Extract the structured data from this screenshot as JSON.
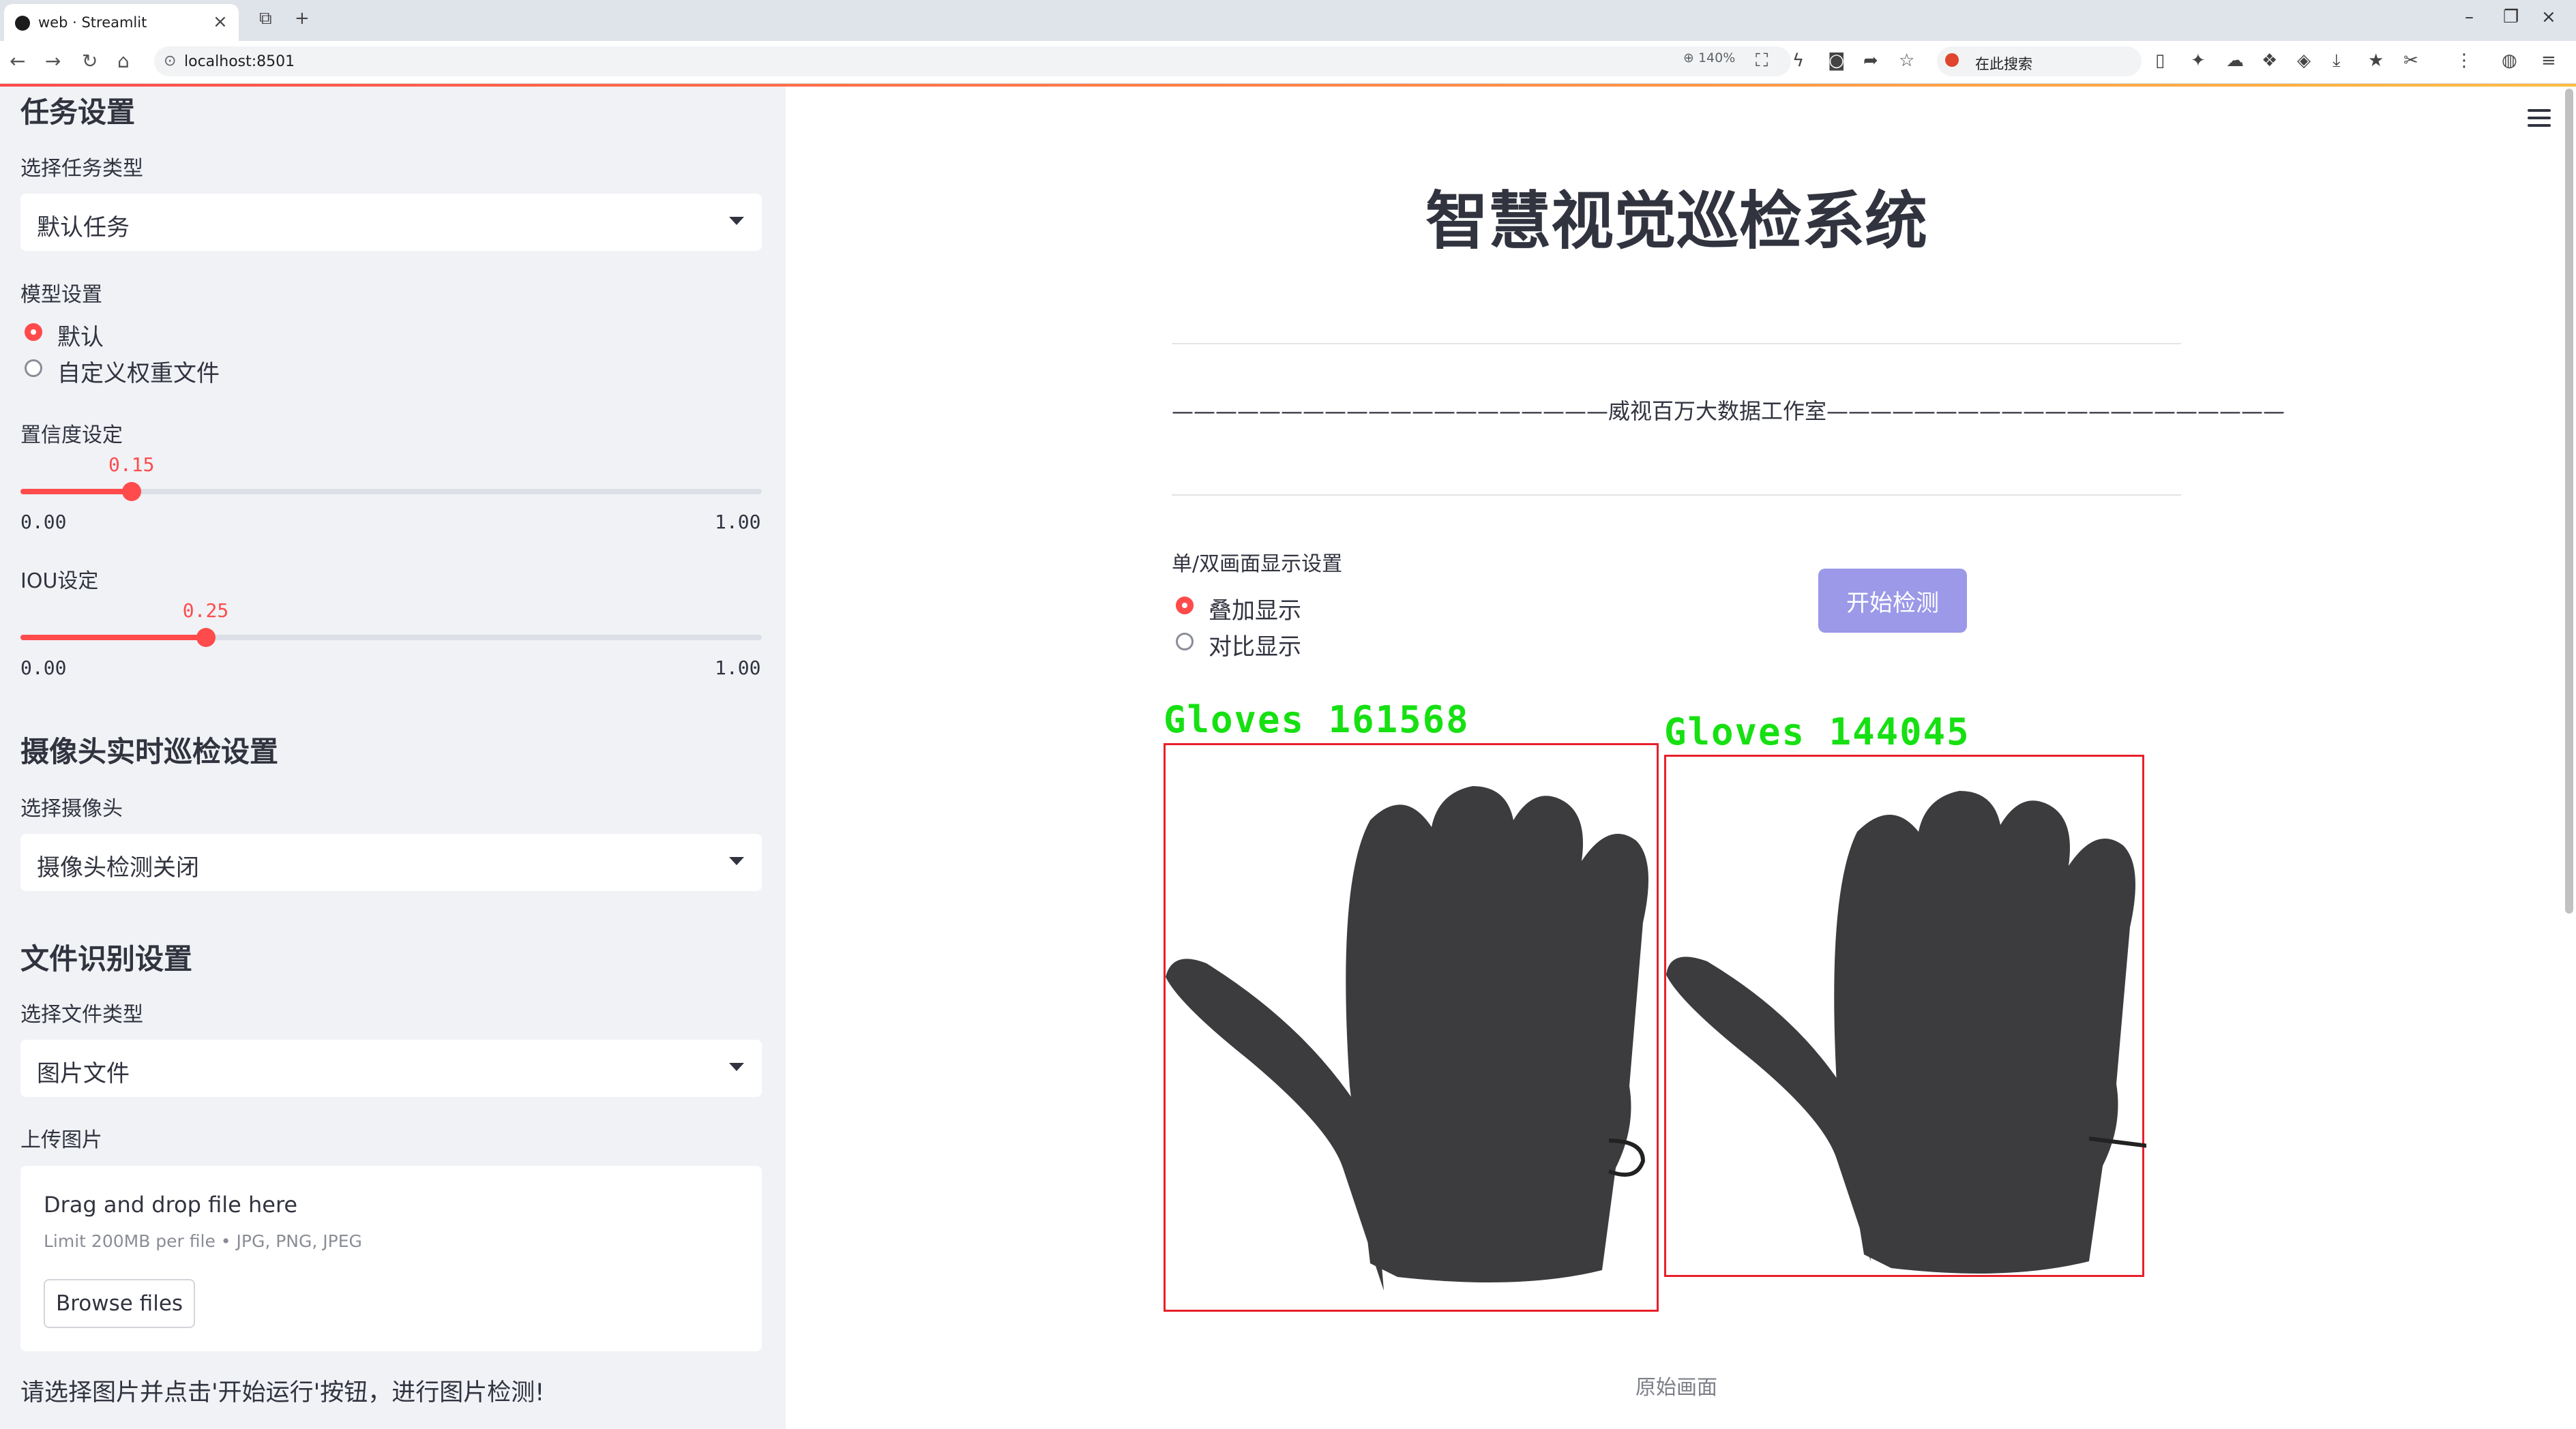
{
  "browser": {
    "tab_title": "web · Streamlit",
    "url": "localhost:8501",
    "zoom": "140%",
    "search_placeholder": "在此搜索"
  },
  "sidebar": {
    "task_header": "任务设置",
    "task_type_label": "选择任务类型",
    "task_type_value": "默认任务",
    "model_label": "模型设置",
    "model_options": [
      {
        "label": "默认",
        "selected": true
      },
      {
        "label": "自定义权重文件",
        "selected": false
      }
    ],
    "confidence": {
      "label": "置信度设定",
      "value": "0.15",
      "value_num": 0.15,
      "min": "0.00",
      "max": "1.00"
    },
    "iou": {
      "label": "IOU设定",
      "value": "0.25",
      "value_num": 0.25,
      "min": "0.00",
      "max": "1.00"
    },
    "camera_header": "摄像头实时巡检设置",
    "camera_label": "选择摄像头",
    "camera_value": "摄像头检测关闭",
    "file_header": "文件识别设置",
    "file_type_label": "选择文件类型",
    "file_type_value": "图片文件",
    "upload_label": "上传图片",
    "uploader": {
      "drag_text": "Drag and drop file here",
      "limit_text": "Limit 200MB per file • JPG, PNG, JPEG",
      "browse_label": "Browse files"
    },
    "hint": "请选择图片并点击'开始运行'按钮，进行图片检测!"
  },
  "main": {
    "title": "智慧视觉巡检系统",
    "studio_line": "————————————————————威视百万大数据工作室—————————————————————",
    "display_label": "单/双画面显示设置",
    "display_options": [
      {
        "label": "叠加显示",
        "selected": true
      },
      {
        "label": "对比显示",
        "selected": false
      }
    ],
    "start_button": "开始检测",
    "detections": [
      {
        "label": "Gloves  161568"
      },
      {
        "label": "Gloves  144045"
      }
    ],
    "caption": "原始画面"
  },
  "colors": {
    "accent": "#ff4b4b",
    "button": "#9b99e8",
    "detection_text": "#16e012",
    "detection_box": "#e8202a",
    "sidebar_bg": "#f0f2f6"
  }
}
